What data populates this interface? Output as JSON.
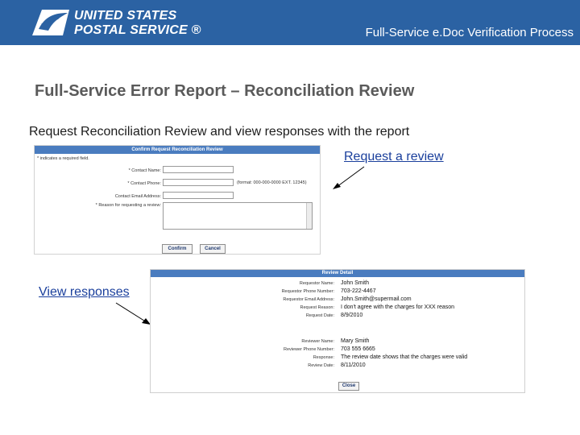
{
  "header": {
    "logo": {
      "line1": "UNITED STATES",
      "line2": "POSTAL SERVICE ®"
    },
    "title": "Full-Service e.Doc Verification Process",
    "background": "#2b62a3"
  },
  "page": {
    "title": "Full-Service Error Report – Reconciliation Review",
    "subtitle": "Request Reconciliation Review and view responses with the report"
  },
  "callouts": {
    "request_review": "Request a review",
    "view_responses": "View responses"
  },
  "request_form": {
    "title": "Confirm Request Reconciliation Review",
    "required_note": "* indicates a required field.",
    "contact_name_label": "* Contact Name:",
    "contact_name_value": "",
    "contact_phone_label": "* Contact Phone:",
    "contact_phone_value": "",
    "phone_format": "(format: 000-000-0000 EXT. 12345)",
    "contact_email_label": "Contact Email Address:",
    "contact_email_value": "",
    "reason_label": "* Reason for requesting a review:",
    "reason_value": "",
    "confirm_label": "Confirm",
    "cancel_label": "Cancel"
  },
  "review_detail": {
    "title": "Review Detail",
    "request": [
      {
        "label": "Requestor Name:",
        "value": "John Smith"
      },
      {
        "label": "Requestor Phone Number:",
        "value": "703-222-4467"
      },
      {
        "label": "Requestor Email Address:",
        "value": "John.Smith@supermail.com"
      },
      {
        "label": "Request Reason:",
        "value": "I don't agree with the charges for XXX reason"
      },
      {
        "label": "Request Date:",
        "value": "8/9/2010"
      }
    ],
    "review": [
      {
        "label": "Reviewer Name:",
        "value": "Mary Smith"
      },
      {
        "label": "Reviewer Phone Number:",
        "value": "703 555 6665"
      },
      {
        "label": "Response:",
        "value": "The review date shows that the charges were valid"
      },
      {
        "label": "Review Date:",
        "value": "8/11/2010"
      }
    ],
    "close_label": "Close"
  }
}
